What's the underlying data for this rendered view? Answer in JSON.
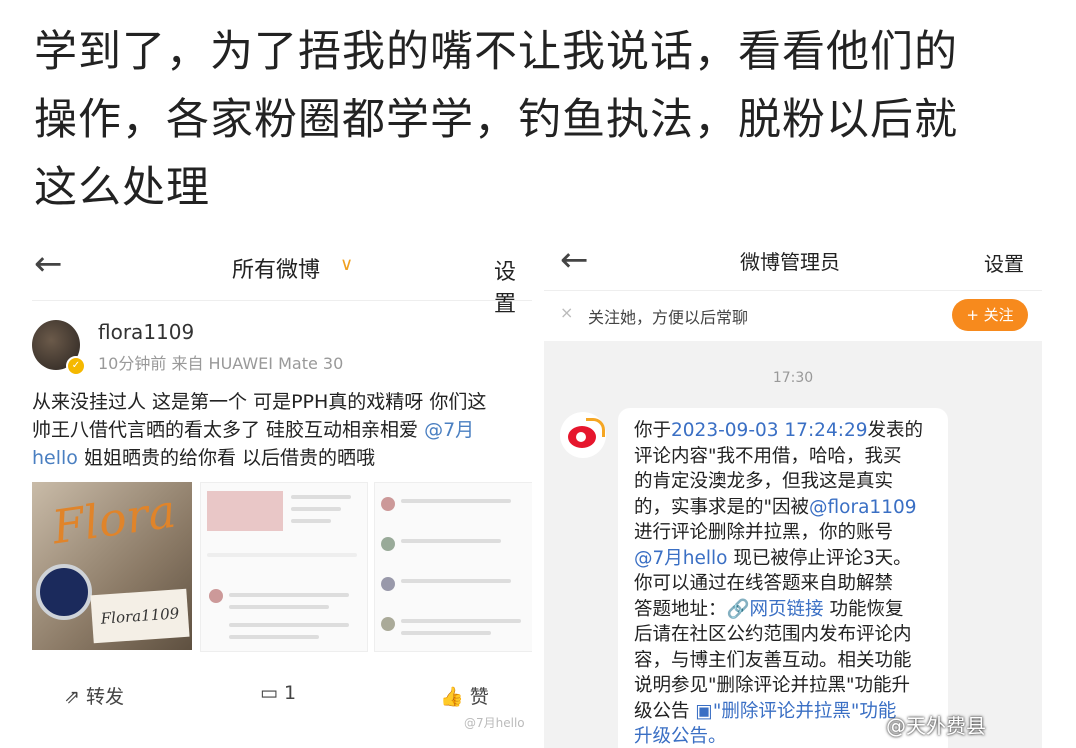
{
  "caption": {
    "line1": "学到了，为了捂我的嘴不让我说话，看看他们的",
    "line2": "操作，各家粉圈都学学，钓鱼执法，脱粉以后就",
    "line3": "这么处理"
  },
  "left": {
    "back": "←",
    "title": "所有微博",
    "chevron": "∨",
    "settings": "设置",
    "username": "flora1109",
    "meta": "10分钟前  来自 HUAWEI Mate 30",
    "post_l1": "从来没挂过人 这是第一个 可是PPH真的戏精呀 你们这",
    "post_l2a": "帅王八借代言晒的看太多了 硅胶互动相亲相爱 ",
    "post_l2b": "@7月",
    "post_l3a": "hello",
    "post_l3b": "  姐姐晒贵的给你看 以后借贵的晒哦",
    "img_text": "Flora",
    "img_card": "Flora1109",
    "repost": "转发",
    "comment": "1",
    "like": "赞",
    "watermark": "@7月hello"
  },
  "right": {
    "back": "←",
    "title": "微博管理员",
    "settings": "设置",
    "close": "×",
    "follow_tip": "关注她，方便以后常聊",
    "follow_btn": "+ 关注",
    "time": "17:30",
    "m1a": "你于",
    "m1b": "2023-09-03 17:24:29",
    "m1c": "发表的",
    "m2": "评论内容\"我不用借，哈哈，我买",
    "m3": "的肯定没澳龙多，但我这是真实",
    "m4a": "的，实事求是的\"因被",
    "m4b": "@flora1109",
    "m5": "进行评论删除并拉黑，你的账号",
    "m6a": "@7月hello",
    "m6b": " 现已被停止评论3天。",
    "m7": "你可以通过在线答题来自助解禁",
    "m8a": "答题地址：",
    "m8b": "🔗网页链接",
    "m8c": " 功能恢复",
    "m9": "后请在社区公约范围内发布评论内",
    "m10": "容，与博主们友善互动。相关功能",
    "m11": "说明参见\"删除评论并拉黑\"功能升",
    "m12a": "级公告 ",
    "m12b": "▣\"删除评论并拉黑\"功能",
    "m13": "升级公告。"
  },
  "footer_watermark": "@天外费县"
}
